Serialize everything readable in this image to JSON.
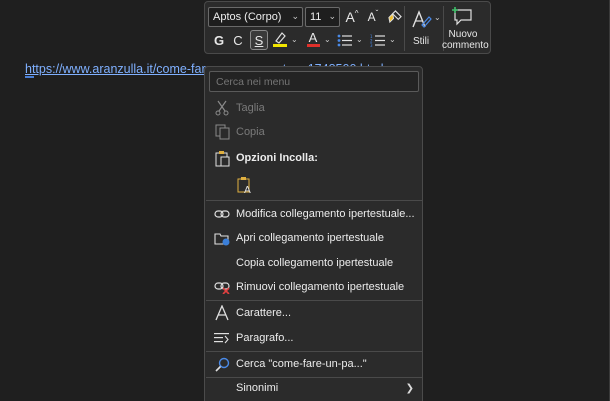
{
  "document": {
    "link_text": "https://www.aranzulla.it/come-fare-un-pas-su-story-1748500.html"
  },
  "toolbar": {
    "font_family": "Aptos (Corpo)",
    "font_size": "11",
    "grow_font": "A",
    "shrink_font": "A",
    "bold": "G",
    "italic": "C",
    "underline": "S",
    "font_color_letter": "A",
    "styles_label": "Stili",
    "new_comment_label_1": "Nuovo",
    "new_comment_label_2": "commento",
    "highlight_color": "#f2e600",
    "font_color": "#e0302a"
  },
  "context_menu": {
    "search_placeholder": "Cerca nei menu",
    "items": [
      {
        "label": "Taglia",
        "icon": "scissors-icon",
        "disabled": true
      },
      {
        "label": "Copia",
        "icon": "copy-icon",
        "disabled": true
      },
      {
        "label": "Opzioni Incolla:",
        "icon": "paste-icon",
        "bold": true
      },
      {
        "label": "Modifica collegamento ipertestuale...",
        "icon": "edit-link-icon"
      },
      {
        "label": "Apri collegamento ipertestuale",
        "icon": "open-link-icon"
      },
      {
        "label": "Copia collegamento ipertestuale",
        "icon": ""
      },
      {
        "label": "Rimuovi collegamento ipertestuale",
        "icon": "remove-link-icon"
      },
      {
        "label": "Carattere...",
        "icon": "font-icon"
      },
      {
        "label": "Paragrafo...",
        "icon": "paragraph-icon"
      },
      {
        "label": "Cerca \"come-fare-un-pa...\"",
        "icon": "search-icon"
      },
      {
        "label": "Sinonimi",
        "icon": "",
        "submenu": true
      }
    ]
  }
}
